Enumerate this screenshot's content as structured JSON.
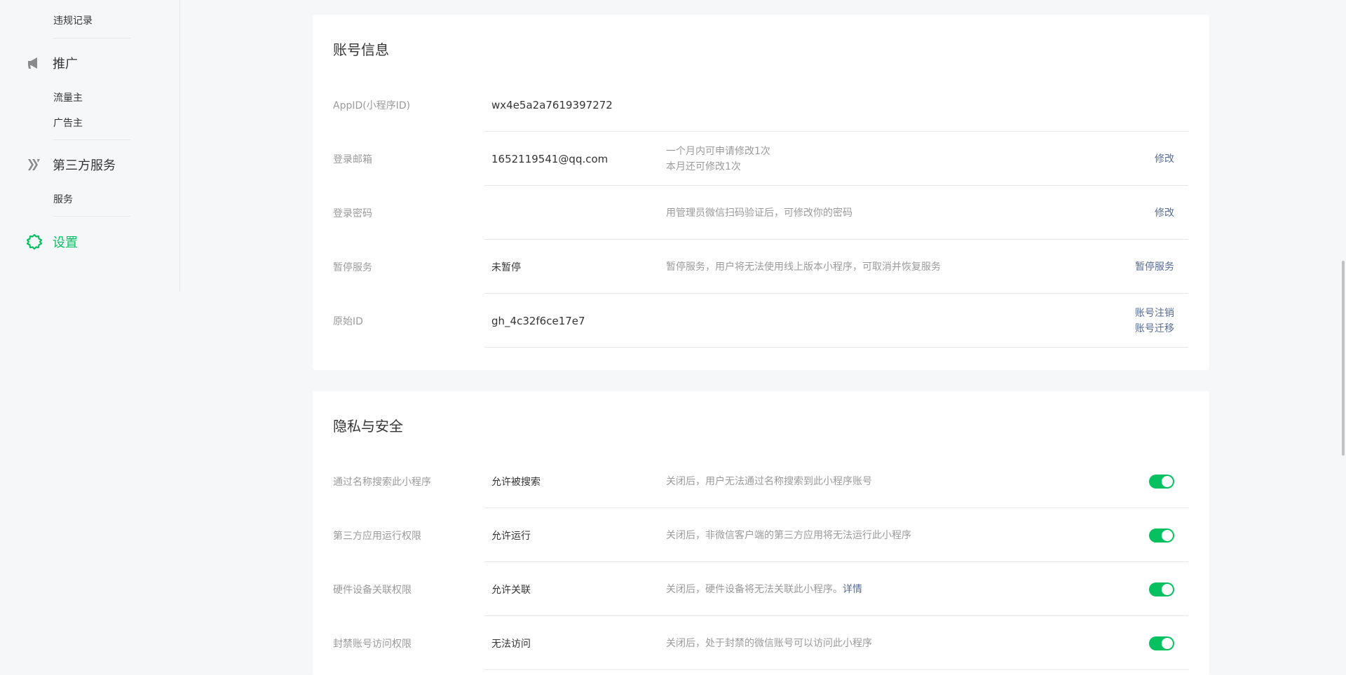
{
  "sidebar": {
    "violation_records": "违规记录",
    "promotion": {
      "label": "推广",
      "icon": "megaphone-icon"
    },
    "traffic_owner": "流量主",
    "advertiser": "广告主",
    "third_party": {
      "label": "第三方服务",
      "icon": "third-party-icon"
    },
    "service": "服务",
    "settings": {
      "label": "设置",
      "icon": "gear-icon",
      "color": "#07c160"
    }
  },
  "account_card": {
    "title": "账号信息",
    "rows": [
      {
        "label": "AppID(小程序ID)",
        "value": "wx4e5a2a7619397272"
      },
      {
        "label": "登录邮箱",
        "value": "1652119541@qq.com",
        "desc_line1": "一个月内可申请修改1次",
        "desc_line2": "本月还可修改1次",
        "action": "修改"
      },
      {
        "label": "登录密码",
        "value": "",
        "desc": "用管理员微信扫码验证后，可修改你的密码",
        "action": "修改"
      },
      {
        "label": "暂停服务",
        "value": "未暂停",
        "desc": "暂停服务，用户将无法使用线上版本小程序，可取消并恢复服务",
        "action": "暂停服务"
      },
      {
        "label": "原始ID",
        "value": "gh_4c32f6ce17e7",
        "action1": "账号注销",
        "action2": "账号迁移"
      }
    ]
  },
  "privacy_card": {
    "title": "隐私与安全",
    "rows": [
      {
        "label": "通过名称搜索此小程序",
        "value": "允许被搜索",
        "desc": "关闭后，用户无法通过名称搜索到此小程序账号",
        "toggle": "on"
      },
      {
        "label": "第三方应用运行权限",
        "value": "允许运行",
        "desc": "关闭后，非微信客户端的第三方应用将无法运行此小程序",
        "toggle": "on"
      },
      {
        "label": "硬件设备关联权限",
        "value": "允许关联",
        "desc": "关闭后，硬件设备将无法关联此小程序。",
        "link": "详情",
        "toggle": "on"
      },
      {
        "label": "封禁账号访问权限",
        "value": "无法访问",
        "desc": "关闭后，处于封禁的微信账号可以访问此小程序",
        "toggle": "on"
      }
    ]
  },
  "colors": {
    "accent": "#07c160",
    "link": "#576b95",
    "muted": "#9a9a9a"
  }
}
